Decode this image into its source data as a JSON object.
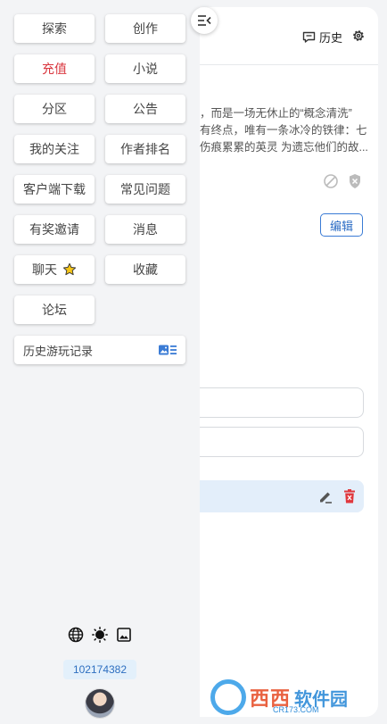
{
  "header": {
    "history_label": "历史"
  },
  "content": {
    "description_lines": [
      "，而是一场无休止的“概念清洗”",
      "有终点，唯有一条冰冷的铁律：七",
      "伤痕累累的英灵 为遗忘他们的故..."
    ],
    "edit_label": "编辑"
  },
  "nav": {
    "items": [
      {
        "label": "探索"
      },
      {
        "label": "创作"
      },
      {
        "label": "充值"
      },
      {
        "label": "小说"
      },
      {
        "label": "分区"
      },
      {
        "label": "公告"
      },
      {
        "label": "我的关注"
      },
      {
        "label": "作者排名"
      },
      {
        "label": "客户端下载"
      },
      {
        "label": "常见问题"
      },
      {
        "label": "有奖邀请"
      },
      {
        "label": "消息"
      },
      {
        "label": "聊天",
        "icon": "star-icon"
      },
      {
        "label": "收藏"
      },
      {
        "label": "论坛"
      }
    ],
    "history_record_label": "历史游玩记录"
  },
  "footer": {
    "user_id": "102174382"
  },
  "watermark": {
    "text1": "西西",
    "text2": "软件园",
    "sub": "CR173.COM"
  },
  "colors": {
    "accent": "#2e6fc0",
    "recharge": "#d9363e",
    "delete": "#e0383e"
  }
}
